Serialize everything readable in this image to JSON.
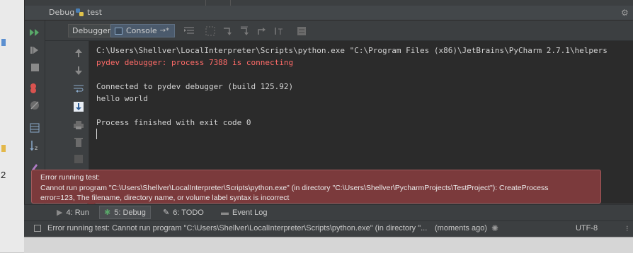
{
  "window": {
    "panel_label": "Debug",
    "config_name": "test"
  },
  "toolbar": {
    "debugger_tab": "Debugger",
    "console_tab": "Console",
    "console_pin": "→*"
  },
  "console": {
    "lines": [
      "C:\\Users\\Shellver\\LocalInterpreter\\Scripts\\python.exe \"C:\\Program Files (x86)\\JetBrains\\PyCharm 2.7.1\\helpers",
      "pydev debugger: process 7388 is connecting",
      "",
      "Connected to pydev debugger (build 125.92)",
      "hello world",
      "",
      "Process finished with exit code 0"
    ]
  },
  "error_balloon": {
    "line1": "Error running test:",
    "line2": "Cannot run program \"C:\\Users\\Shellver\\LocalInterpreter\\Scripts\\python.exe\" (in directory \"C:\\Users\\Shellver\\PycharmProjects\\TestProject\"): CreateProcess",
    "line3": "error=123, The filename, directory name, or volume label syntax is incorrect"
  },
  "bottom_tabs": {
    "run": "4: Run",
    "debug": "5: Debug",
    "todo": "6: TODO",
    "event_log": "Event Log"
  },
  "status_bar": {
    "message": "Error running test: Cannot run program \"C:\\Users\\Shellver\\LocalInterpreter\\Scripts\\python.exe\" (in directory \"...",
    "time": "(moments ago)",
    "encoding": "UTF-8"
  },
  "desktop": {
    "number": "2"
  },
  "colors": {
    "console_bg": "#2b2b2b",
    "error_text": "#ff6b68",
    "balloon_bg": "#7b3a3c",
    "ide_bg": "#3c3f41"
  }
}
